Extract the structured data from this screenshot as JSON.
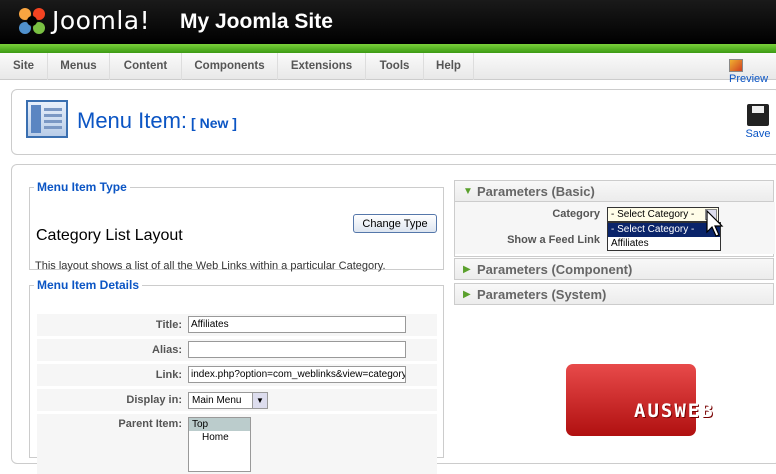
{
  "header": {
    "brand": "Joomla!",
    "site_title": "My Joomla Site"
  },
  "menubar": {
    "items": [
      "Site",
      "Menus",
      "Content",
      "Components",
      "Extensions",
      "Tools",
      "Help"
    ],
    "preview_label": "Preview"
  },
  "toolbar": {
    "title": "Menu Item:",
    "subtitle": "[ New ]",
    "save_label": "Save"
  },
  "menu_item_type": {
    "legend": "Menu Item Type",
    "title": "Category List Layout",
    "change_button": "Change Type",
    "description": "This layout shows a list of all the Web Links within a particular Category."
  },
  "menu_item_details": {
    "legend": "Menu Item Details",
    "title_label": "Title:",
    "title_value": "Affiliates",
    "alias_label": "Alias:",
    "alias_value": "",
    "link_label": "Link:",
    "link_value": "index.php?option=com_weblinks&view=category",
    "display_label": "Display in:",
    "display_value": "Main Menu",
    "parent_label": "Parent Item:",
    "parent_options": [
      "Top",
      "Home"
    ]
  },
  "parameters": {
    "basic_label": "Parameters (Basic)",
    "category_label": "Category",
    "category_selected": "- Select Category -",
    "category_options": [
      "- Select Category -",
      "Affiliates"
    ],
    "feed_label": "Show a Feed Link",
    "component_label": "Parameters (Component)",
    "system_label": "Parameters (System)"
  },
  "watermark": {
    "text": "AUSWEB"
  },
  "colors": {
    "accent": "#0b55c4",
    "green": "#5aa02c"
  }
}
